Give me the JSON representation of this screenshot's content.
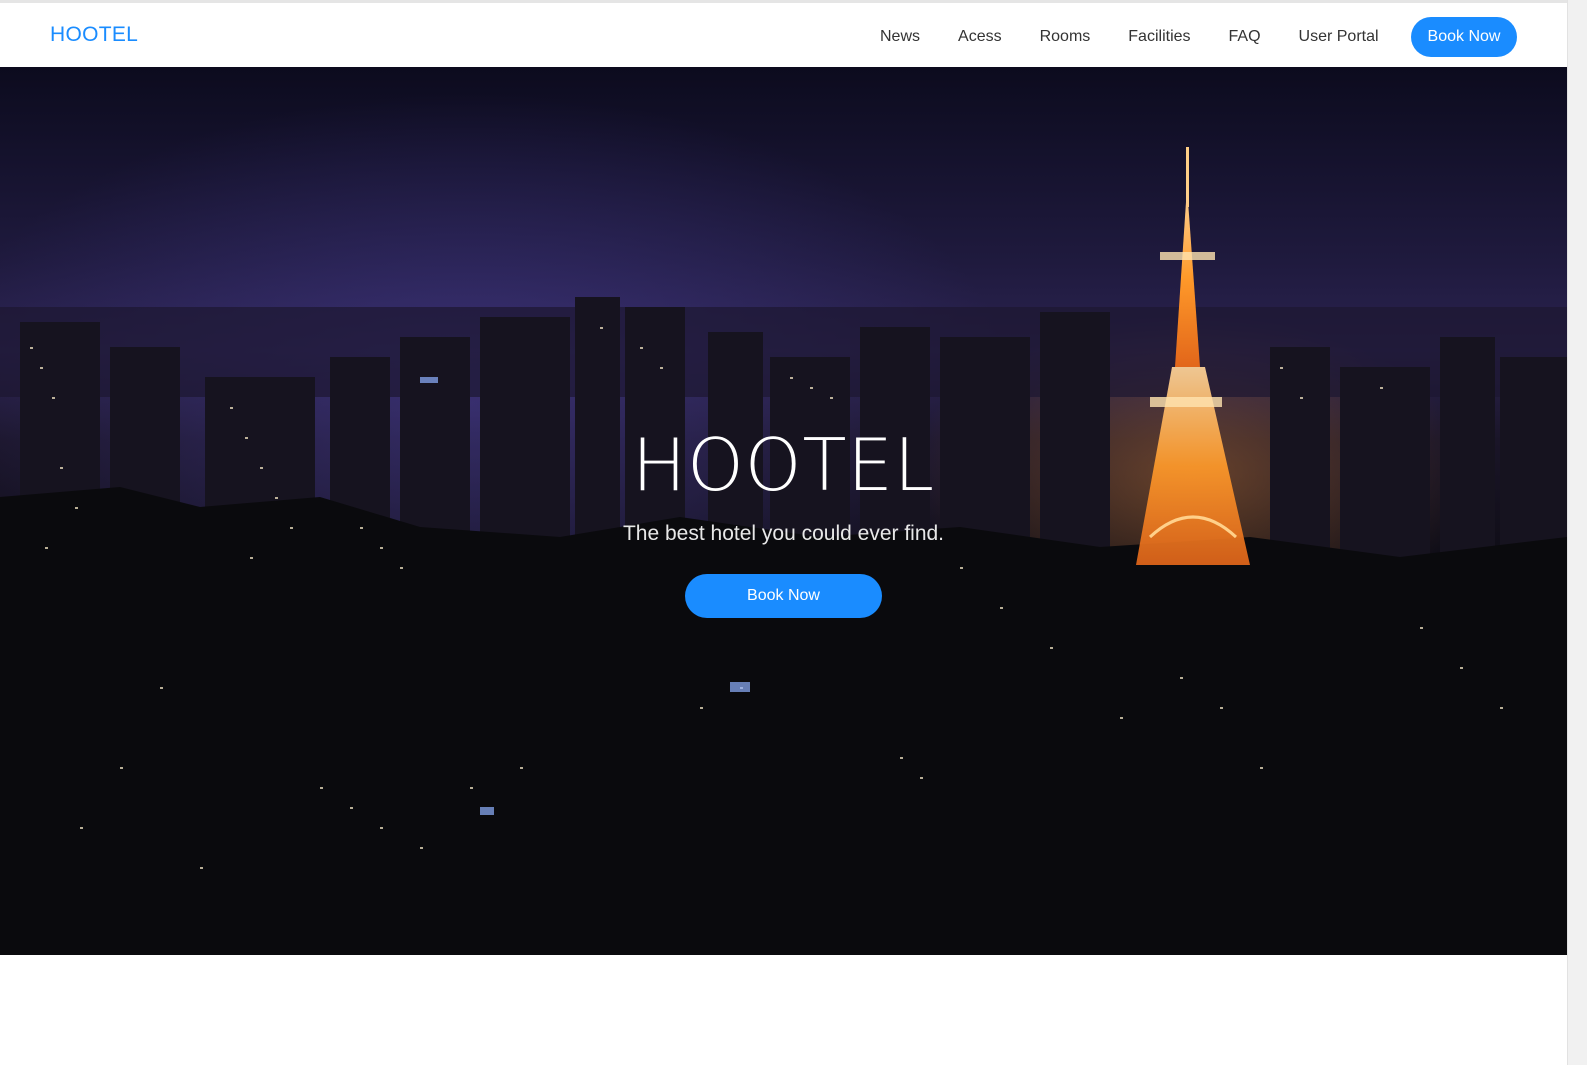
{
  "nav": {
    "brand": "HOOTEL",
    "links": [
      "News",
      "Acess",
      "Rooms",
      "Facilities",
      "FAQ",
      "User Portal"
    ],
    "cta_label": "Book Now"
  },
  "hero": {
    "title": "HOOTEL",
    "subtitle": "The best hotel you could ever find.",
    "cta_label": "Book Now",
    "background": "night-city-skyline-with-illuminated-tower-photo"
  },
  "colors": {
    "accent": "#1a8cff",
    "nav_text": "#333333",
    "hero_text": "#ffffff"
  }
}
